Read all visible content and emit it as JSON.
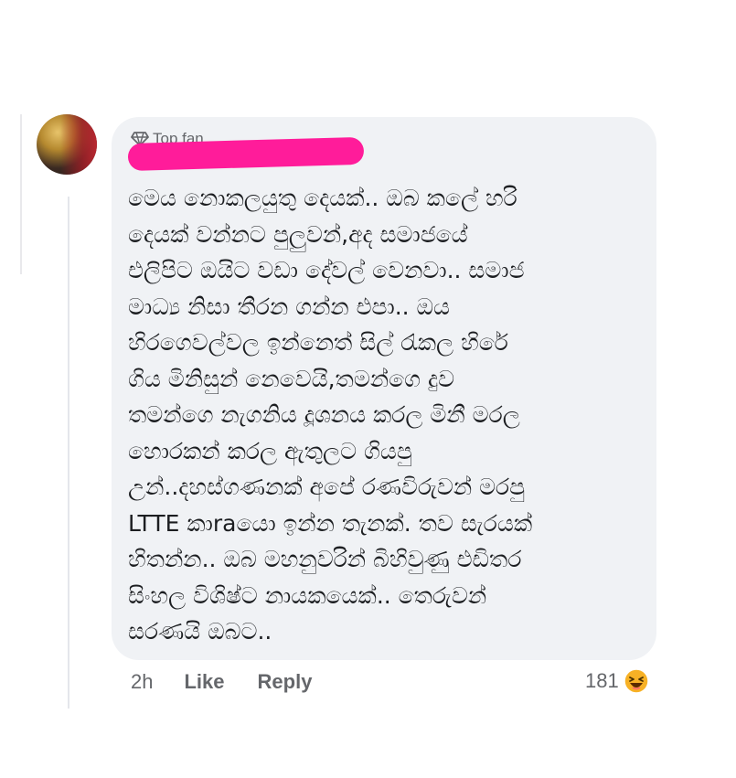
{
  "comment": {
    "badge_label": "Top fan",
    "badge_icon": "diamond-icon",
    "author_name_redacted": true,
    "redaction_color": "#ff1c9a",
    "text": "මෙය නොකලයුතු දෙයක්.. ඔබ කලේ හරි\nදෙයක් වන්නට පුලුවන්,අද සමාජයේ\nඑලිපිට ඔයිට වඩා දේවල් වෙනවා.. සමාජ\nමාධ්‍ය නිසා තීරන ගන්න එපා.. ඔය\nහිරගෙවල්වල ඉන්නෙත් සිල් රැකල හිරේ\nගිය මිනිසුන් නෙවෙයි,තමන්ගෙ දුව\nතමන්ගෙ නැගනිය දූශනය කරල මිනී මරල\nහොරකන් කරල ඇතුලට ගියපු\nඋන්..දහස්ගණනක් අපේ රණවිරුවන් මරපු\nLTTE කාraයො ඉන්න තැනක්. තව සැරයක්\nහිතන්න.. ඔබ මහනුවරින් බිහිවුණු එඩිතර\nසිංහල විශිෂ්ට නායකයෙක්.. තෙරුවන්\nසරණයි ඔබට..",
    "bubble_color": "#f0f2f5"
  },
  "actions": {
    "time": "2h",
    "like_label": "Like",
    "reply_label": "Reply"
  },
  "reactions": {
    "count": "181",
    "icon": "haha-emoji-icon",
    "icon_color": "#f7b125"
  }
}
